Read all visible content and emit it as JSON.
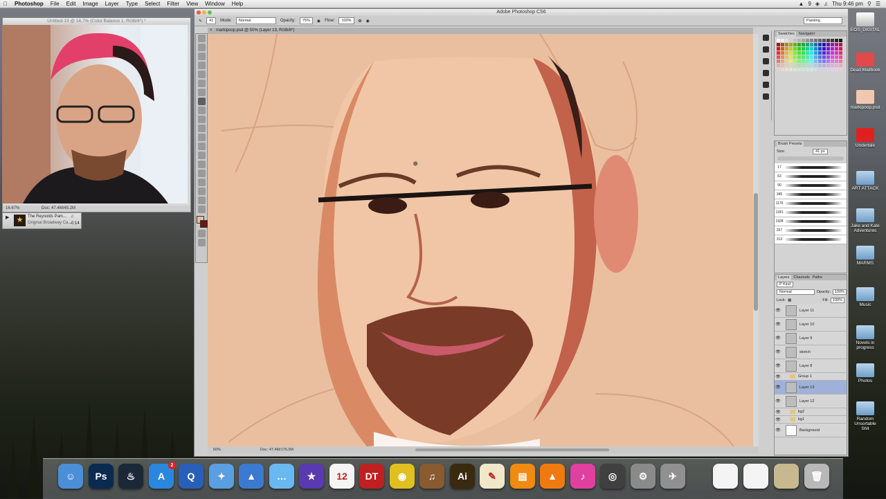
{
  "menubar": {
    "apple": "",
    "app": "Photoshop",
    "items": [
      "File",
      "Edit",
      "Image",
      "Layer",
      "Type",
      "Select",
      "Filter",
      "View",
      "Window",
      "Help"
    ],
    "status": {
      "num": "9",
      "clock": "Thu 9:46 pm"
    }
  },
  "ref_window": {
    "title": "Untitled-19 @ 16.7% (Color Balance 1, RGB/8*) *",
    "zoom": "16.67%",
    "doc": "Doc: 47.4M/45.2M"
  },
  "mini_player": {
    "track": "The Reynolds Pam...",
    "album": "Original Broadway Ca...",
    "time": "-0:14"
  },
  "photoshop": {
    "title": "Adobe Photoshop CS6",
    "doc_tab": "markipoop.psd @ 50% (Layer 13, RGB/8*)",
    "options": {
      "mode_label": "Mode:",
      "mode": "Normal",
      "opacity_label": "Opacity:",
      "opacity": "75%",
      "flow_label": "Flow:",
      "flow": "100%",
      "brush_size": "41",
      "workspace": "Painting"
    },
    "status": {
      "zoom": "50%",
      "doc": "Doc: 47.4M/176.0M"
    }
  },
  "panels": {
    "swatches": {
      "tabs": [
        "Swatches",
        "Navigator"
      ]
    },
    "brush_presets": {
      "title": "Brush Presets",
      "size_label": "Size:",
      "size": "41 px",
      "brushes": [
        "17",
        "63",
        "90",
        "345",
        "1176",
        "1181",
        "1928",
        "257",
        "313"
      ]
    },
    "layers": {
      "tabs": [
        "Layers",
        "Channels",
        "Paths"
      ],
      "kind": "P Kind",
      "blend": "Normal",
      "opacity_label": "Opacity:",
      "opacity": "100%",
      "lock_label": "Lock:",
      "fill_label": "Fill:",
      "fill": "100%",
      "rows": [
        {
          "name": "Layer 11",
          "type": "layer",
          "selected": false
        },
        {
          "name": "Layer 10",
          "type": "layer",
          "selected": false
        },
        {
          "name": "Layer 9",
          "type": "layer",
          "selected": false
        },
        {
          "name": "sketch",
          "type": "layer",
          "selected": false
        },
        {
          "name": "Layer 8",
          "type": "layer",
          "selected": false
        },
        {
          "name": "Group 1",
          "type": "group",
          "selected": false
        },
        {
          "name": "Layer 13",
          "type": "layer",
          "selected": true
        },
        {
          "name": "Layer 12",
          "type": "layer",
          "selected": false
        },
        {
          "name": "bg2",
          "type": "group",
          "selected": false
        },
        {
          "name": "bg1",
          "type": "group",
          "selected": false
        },
        {
          "name": "Background",
          "type": "layer",
          "selected": false
        }
      ]
    }
  },
  "desktop_icons": [
    "EOS_DIGITAL",
    "Dead Mailbook",
    "markipoop.psd",
    "Undertale",
    "ART ATTACK",
    "Jake and Kate Adventures",
    "MARMS",
    "Music",
    "Novels in progress",
    "Photos",
    "Random Unsortable Shit"
  ],
  "dock": {
    "items": [
      {
        "name": "finder",
        "label": "☺",
        "color": "#4a8fd8"
      },
      {
        "name": "photoshop",
        "label": "Ps",
        "color": "#0a2b4f"
      },
      {
        "name": "steam",
        "label": "♨",
        "color": "#1b2838"
      },
      {
        "name": "app-store",
        "label": "A",
        "color": "#2a87de",
        "badge": "2"
      },
      {
        "name": "quicktime",
        "label": "Q",
        "color": "#2860b8"
      },
      {
        "name": "safari",
        "label": "✦",
        "color": "#5a9fe0"
      },
      {
        "name": "keynote",
        "label": "▲",
        "color": "#3a7ad0"
      },
      {
        "name": "messages",
        "label": "…",
        "color": "#6ab8f0"
      },
      {
        "name": "imovie",
        "label": "★",
        "color": "#5a3ab0"
      },
      {
        "name": "calendar",
        "label": "12",
        "color": "#f4f4f4"
      },
      {
        "name": "dt",
        "label": "DT",
        "color": "#c02020"
      },
      {
        "name": "chrome",
        "label": "◉",
        "color": "#e0c020"
      },
      {
        "name": "garageband",
        "label": "♫",
        "color": "#8a5a30"
      },
      {
        "name": "illustrator",
        "label": "Ai",
        "color": "#3a2a10"
      },
      {
        "name": "textedit",
        "label": "✎",
        "color": "#f0e8c8"
      },
      {
        "name": "ibooks",
        "label": "▤",
        "color": "#f08a10"
      },
      {
        "name": "vlc",
        "label": "▲",
        "color": "#f07a10"
      },
      {
        "name": "itunes",
        "label": "♪",
        "color": "#e040a0"
      },
      {
        "name": "photo-booth",
        "label": "◎",
        "color": "#404040"
      },
      {
        "name": "system-preferences",
        "label": "⚙",
        "color": "#8a8a8a"
      },
      {
        "name": "launchpad",
        "label": "✈",
        "color": "#909090"
      },
      {
        "name": "document-1",
        "label": "",
        "color": "#f4f4f4"
      },
      {
        "name": "document-2",
        "label": "",
        "color": "#f4f4f4"
      },
      {
        "name": "downloads-stack",
        "label": "",
        "color": "#c8b890"
      },
      {
        "name": "trash",
        "label": "🗑",
        "color": "#b8b8b8"
      }
    ]
  }
}
